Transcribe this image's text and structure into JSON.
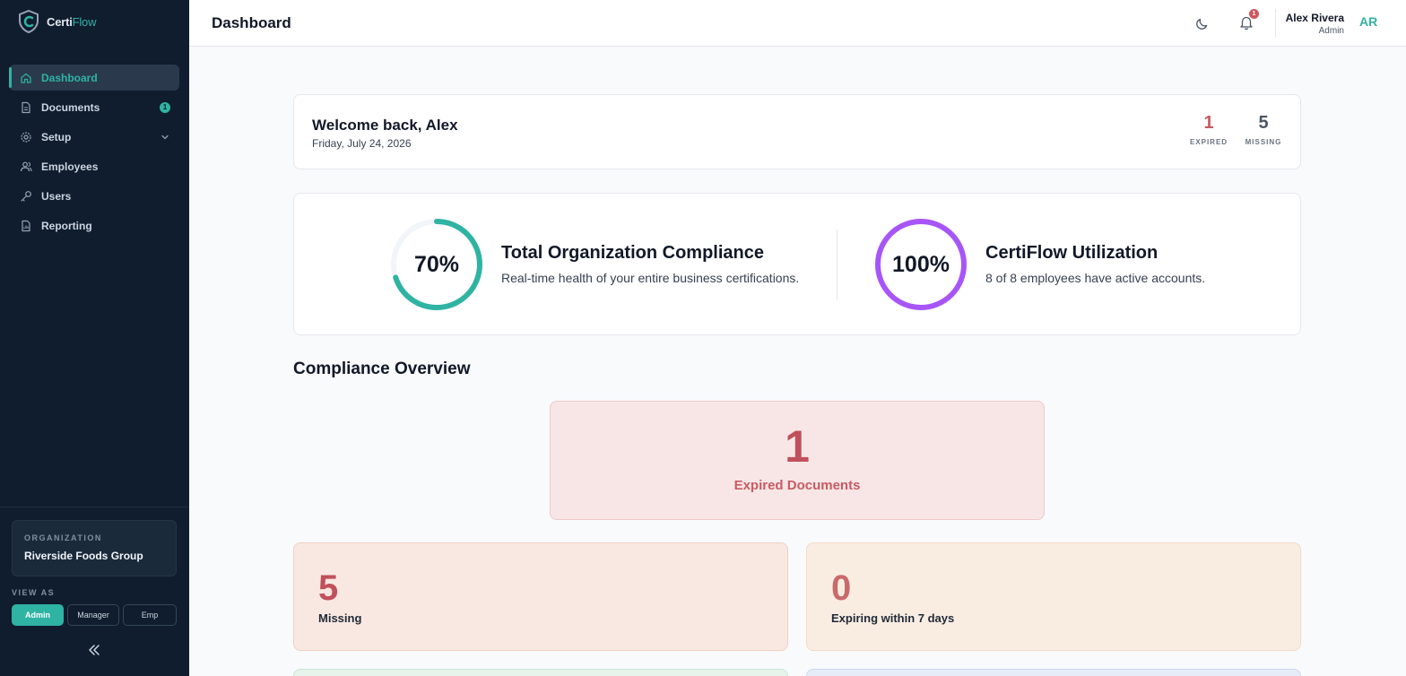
{
  "brand": {
    "name_part1": "Certi",
    "name_part2": "Flow",
    "accent_color": "#2fb3a3"
  },
  "sidebar": {
    "items": [
      {
        "label": "Dashboard",
        "icon": "home-icon",
        "active": true
      },
      {
        "label": "Documents",
        "icon": "document-icon",
        "badge": "1"
      },
      {
        "label": "Setup",
        "icon": "gear-icon",
        "expandable": true
      },
      {
        "label": "Employees",
        "icon": "users-icon"
      },
      {
        "label": "Users",
        "icon": "key-icon"
      },
      {
        "label": "Reporting",
        "icon": "report-icon"
      }
    ],
    "organization_label": "ORGANIZATION",
    "organization_name": "Riverside Foods Group",
    "view_as_label": "VIEW AS",
    "view_as_options": [
      "Admin",
      "Manager",
      "Emp"
    ],
    "view_as_selected": "Admin"
  },
  "header": {
    "title": "Dashboard",
    "notification_count": "1",
    "user_name": "Alex Rivera",
    "user_role": "Admin",
    "user_initials": "AR"
  },
  "welcome": {
    "title": "Welcome back, Alex",
    "date": "Friday, July 24, 2026",
    "expired_count": "1",
    "expired_label": "EXPIRED",
    "missing_count": "5",
    "missing_label": "MISSING"
  },
  "summary": {
    "compliance": {
      "percent_text": "70%",
      "percent_value": 70,
      "title": "Total Organization Compliance",
      "subtitle": "Real-time health of your entire business certifications.",
      "color": "#2fb3a3"
    },
    "utilization": {
      "percent_text": "100%",
      "percent_value": 100,
      "title": "CertiFlow Utilization",
      "subtitle": "8 of 8 employees have active accounts.",
      "color": "#a855f7"
    }
  },
  "overview": {
    "title": "Compliance Overview",
    "expired": {
      "value": "1",
      "label": "Expired Documents"
    },
    "missing": {
      "value": "5",
      "label": "Missing"
    },
    "expiring": {
      "value": "0",
      "label": "Expiring within 7 days"
    }
  }
}
